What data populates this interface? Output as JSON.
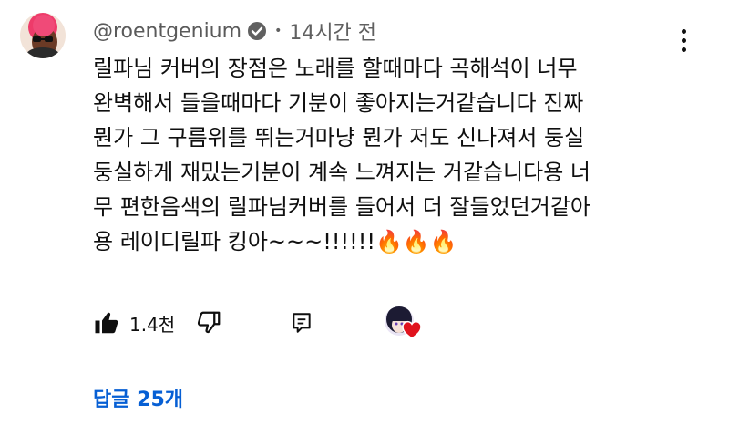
{
  "comment": {
    "author": "@roentgenium",
    "time": "14시간 전",
    "separator": "•",
    "lines": [
      "릴파님 커버의 장점은 노래를 할때마다 곡해석이 너무",
      "완벽해서 들을때마다 기분이 좋아지는거같습니다 진짜",
      "뭔가 그 구름위를 뛰는거마냥 뭔가 저도 신나져서 둥실",
      "둥실하게 재밌는기분이 계속 느껴지는 거같습니다용 너",
      "무 편한음색의 릴파님커버를 들어서 더 잘들었던거같아",
      "용 레이디릴파 킹아~~~!!!!!!"
    ],
    "emoji": [
      "🔥",
      "🔥",
      "🔥"
    ]
  },
  "actions": {
    "like_count": "1.4천"
  },
  "replies": {
    "label": "답글 25개"
  },
  "colors": {
    "link_blue": "#065fd4",
    "heart_red": "#e0131d",
    "avatar_pink": "#ee3b6a"
  },
  "icons": {
    "verified": "verified-check-icon",
    "more": "more-vert-icon",
    "like": "thumb-up-filled-icon",
    "dislike": "thumb-down-outline-icon",
    "reply": "comment-reply-icon",
    "heart": "heart-icon"
  }
}
